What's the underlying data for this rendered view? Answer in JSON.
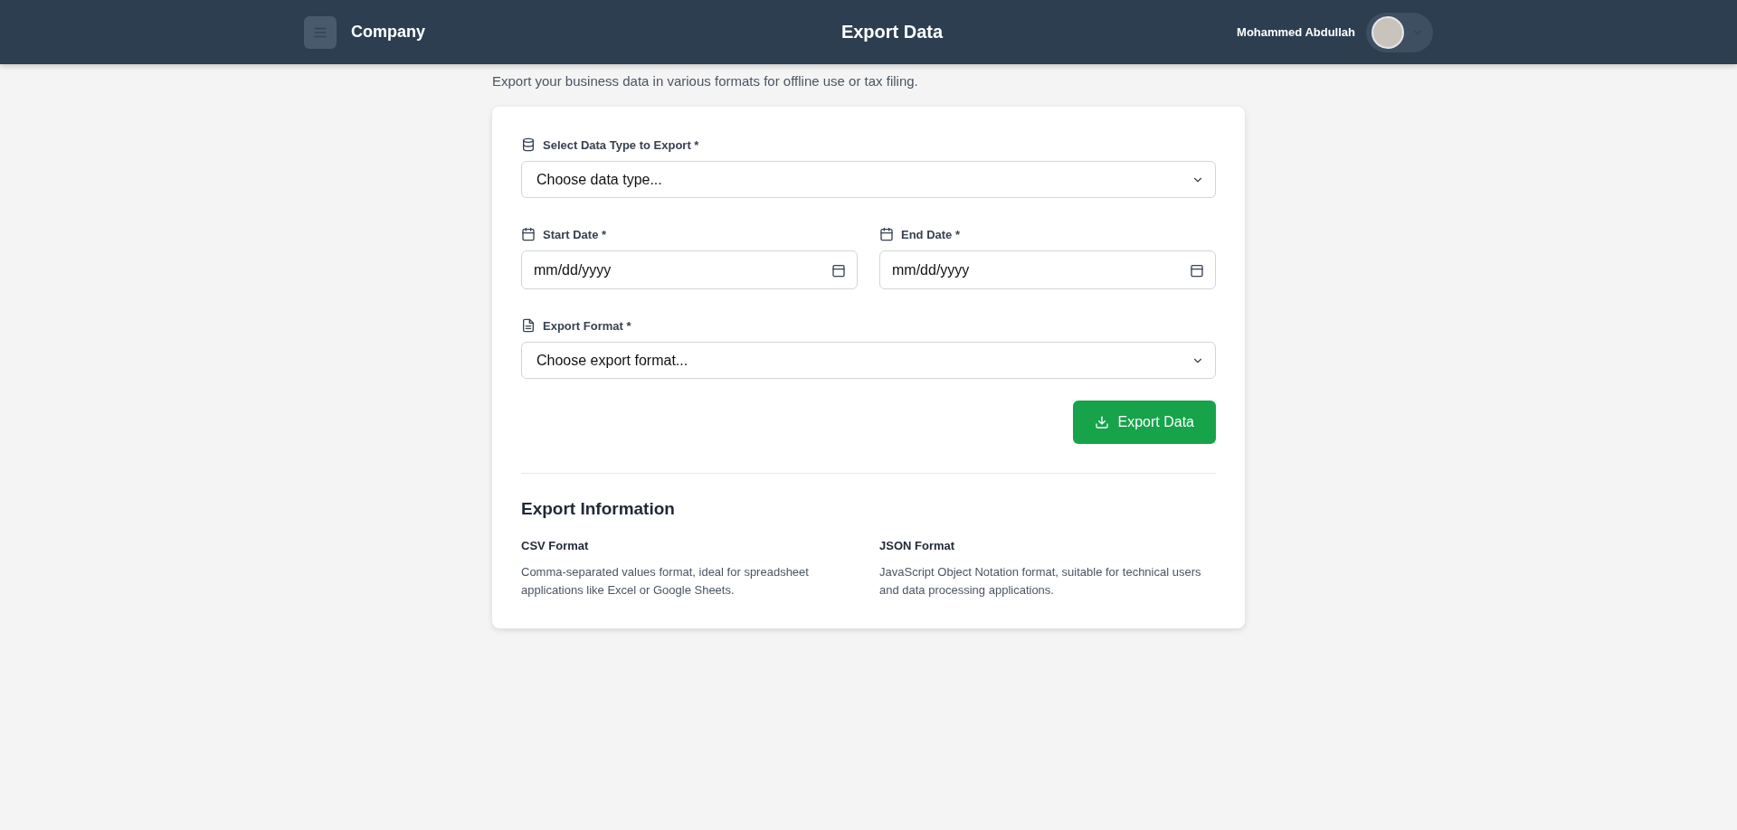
{
  "header": {
    "brand": "Company",
    "title": "Export Data",
    "user_name": "Mohammed Abdullah"
  },
  "subtitle": "Export your business data in various formats for offline use or tax filing.",
  "form": {
    "data_type": {
      "label": "Select Data Type to Export *",
      "placeholder": "Choose data type..."
    },
    "dates": [
      {
        "label": "Start Date *",
        "placeholder": "mm/dd/yyyy"
      },
      {
        "label": "End Date *",
        "placeholder": "mm/dd/yyyy"
      }
    ],
    "format": {
      "label": "Export Format *",
      "placeholder": "Choose export format..."
    },
    "submit": "Export Data"
  },
  "info": {
    "title": "Export Information",
    "items": [
      {
        "title": "CSV Format",
        "description": "Comma-separated values format, ideal for spreadsheet applications like Excel or Google Sheets."
      },
      {
        "title": "JSON Format",
        "description": "JavaScript Object Notation format, suitable for technical users and data processing applications."
      }
    ]
  }
}
